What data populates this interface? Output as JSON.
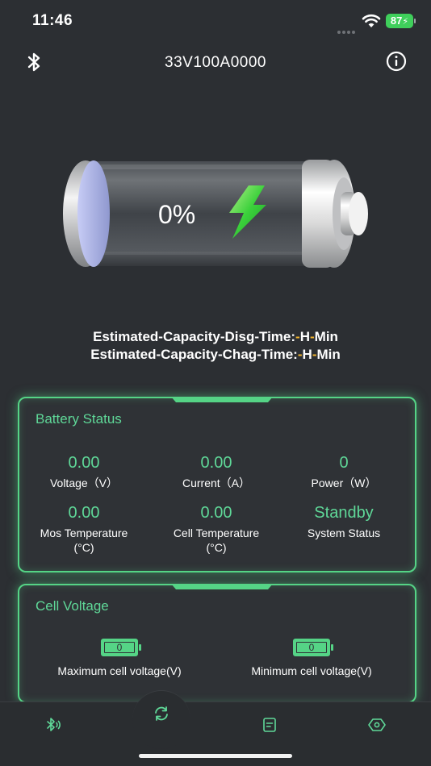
{
  "status_bar": {
    "time": "11:46",
    "battery_level": "87"
  },
  "header": {
    "device_name": "33V100A0000"
  },
  "battery": {
    "percent": "0%"
  },
  "estimates": {
    "disg_prefix": "Estimated-Capacity-Disg-Time:",
    "chag_prefix": "Estimated-Capacity-Chag-Time:",
    "h_value": "-",
    "h_unit": "H",
    "min_value": "-",
    "min_unit": "Min"
  },
  "battery_status": {
    "title": "Battery Status",
    "metrics": [
      {
        "value": "0.00",
        "label": "Voltage（V）"
      },
      {
        "value": "0.00",
        "label": "Current（A）"
      },
      {
        "value": "0",
        "label": "Power（W）"
      },
      {
        "value": "0.00",
        "label": "Mos Temperature",
        "unit": "(°C)"
      },
      {
        "value": "0.00",
        "label": "Cell Temperature",
        "unit": "(°C)"
      },
      {
        "value": "Standby",
        "label": "System Status"
      }
    ]
  },
  "cell_voltage": {
    "title": "Cell Voltage",
    "max_value": "0",
    "max_label": "Maximum cell voltage(V)",
    "min_value": "0",
    "min_label": "Minimum cell voltage(V)"
  },
  "colors": {
    "accent": "#55d486",
    "accent_text": "#5fd898",
    "highlight": "#f3b42c",
    "background": "#2c2f33"
  },
  "tab_bar": {
    "icons": [
      "bluetooth-signal-icon",
      "refresh-icon",
      "document-icon",
      "settings-hex-icon"
    ]
  }
}
